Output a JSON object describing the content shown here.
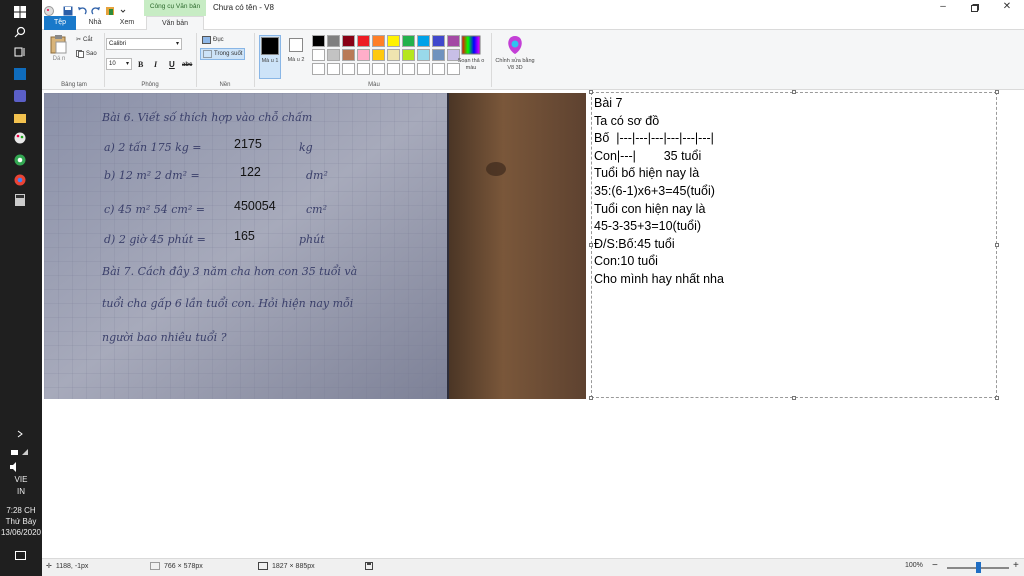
{
  "taskbar": {
    "language": "VIE",
    "input_mode": "IN",
    "time": "7:28 CH",
    "day": "Thứ Bảy",
    "date": "13/06/2020"
  },
  "titlebar": {
    "context_tab": "Công cụ Văn bản",
    "title": "Chưa có tên - V8"
  },
  "tabs": [
    {
      "label": "Tệp"
    },
    {
      "label": "Nhà"
    },
    {
      "label": "Xem"
    },
    {
      "label": "Văn bản"
    }
  ],
  "ribbon": {
    "clipboard": {
      "paste_label": "Dá n",
      "cut_label": "Cắt",
      "copy_label": "Sao",
      "group_label": "Bảng tạm"
    },
    "font": {
      "family": "Calibri",
      "size": "10",
      "bold": "B",
      "italic": "I",
      "underline": "U",
      "strike": "abc",
      "group_label": "Phông"
    },
    "background": {
      "opaque_label": "Đục",
      "transparent_label": "Trong suốt",
      "group_label": "Nền"
    },
    "colors": {
      "color1_label": "Mà u 1",
      "color2_label": "Mà u 2",
      "edit_colors_label": "Soạn thả o màu",
      "paint3d_label": "Chỉnh sửa bằng V8 3D",
      "group_label": "Màu",
      "color1": "#000000",
      "color2": "#ffffff",
      "palette": [
        "#000000",
        "#7f7f7f",
        "#880015",
        "#ed1c24",
        "#ff7f27",
        "#fff200",
        "#22b14c",
        "#00a2e8",
        "#3f48cc",
        "#a349a4",
        "#ffffff",
        "#c3c3c3",
        "#b97a57",
        "#ffaec9",
        "#ffc90e",
        "#efe4b0",
        "#b5e61d",
        "#99d9ea",
        "#7092be",
        "#c8bfe7",
        "#ffffff",
        "#ffffff",
        "#ffffff",
        "#ffffff",
        "#ffffff",
        "#ffffff",
        "#ffffff",
        "#ffffff",
        "#ffffff",
        "#ffffff"
      ]
    }
  },
  "notebook": {
    "lines": [
      "Bài 6. Viết số thích hợp vào chỗ chấm",
      "a) 2 tấn 175 kg =",
      "b) 12 m² 2 dm² =",
      "c) 45 m² 54 cm² =",
      "d) 2 giờ 45 phút =",
      "Bài 7. Cách đây 3 năm cha hơn con 35 tuổi và",
      "tuổi cha gấp 6 lần tuổi con. Hỏi hiện nay mỗi",
      "người bao nhiêu tuổi ?"
    ],
    "units": [
      "kg",
      "dm²",
      "cm²",
      "phút"
    ],
    "answers": [
      "2175",
      "122",
      "450054",
      "165"
    ]
  },
  "textbox": {
    "lines": [
      "Bài 7",
      "Ta có sơ đồ",
      "Bố  |---|---|---|---|---|---|",
      "Con|---|        35 tuổi",
      "Tuổi bố hiện nay là",
      "35:(6-1)x6+3=45(tuổi)",
      "Tuổi con hiện nay là",
      "45-3-35+3=10(tuổi)",
      "Đ/S:Bố:45 tuổi",
      "Con:10 tuổi",
      "Cho mình hay nhất nha"
    ]
  },
  "status": {
    "cursor_pos": "1188, -1px",
    "selection_size": "766 × 578px",
    "canvas_size": "1827 × 885px",
    "zoom": "100%",
    "zoom_level": 0.5
  }
}
